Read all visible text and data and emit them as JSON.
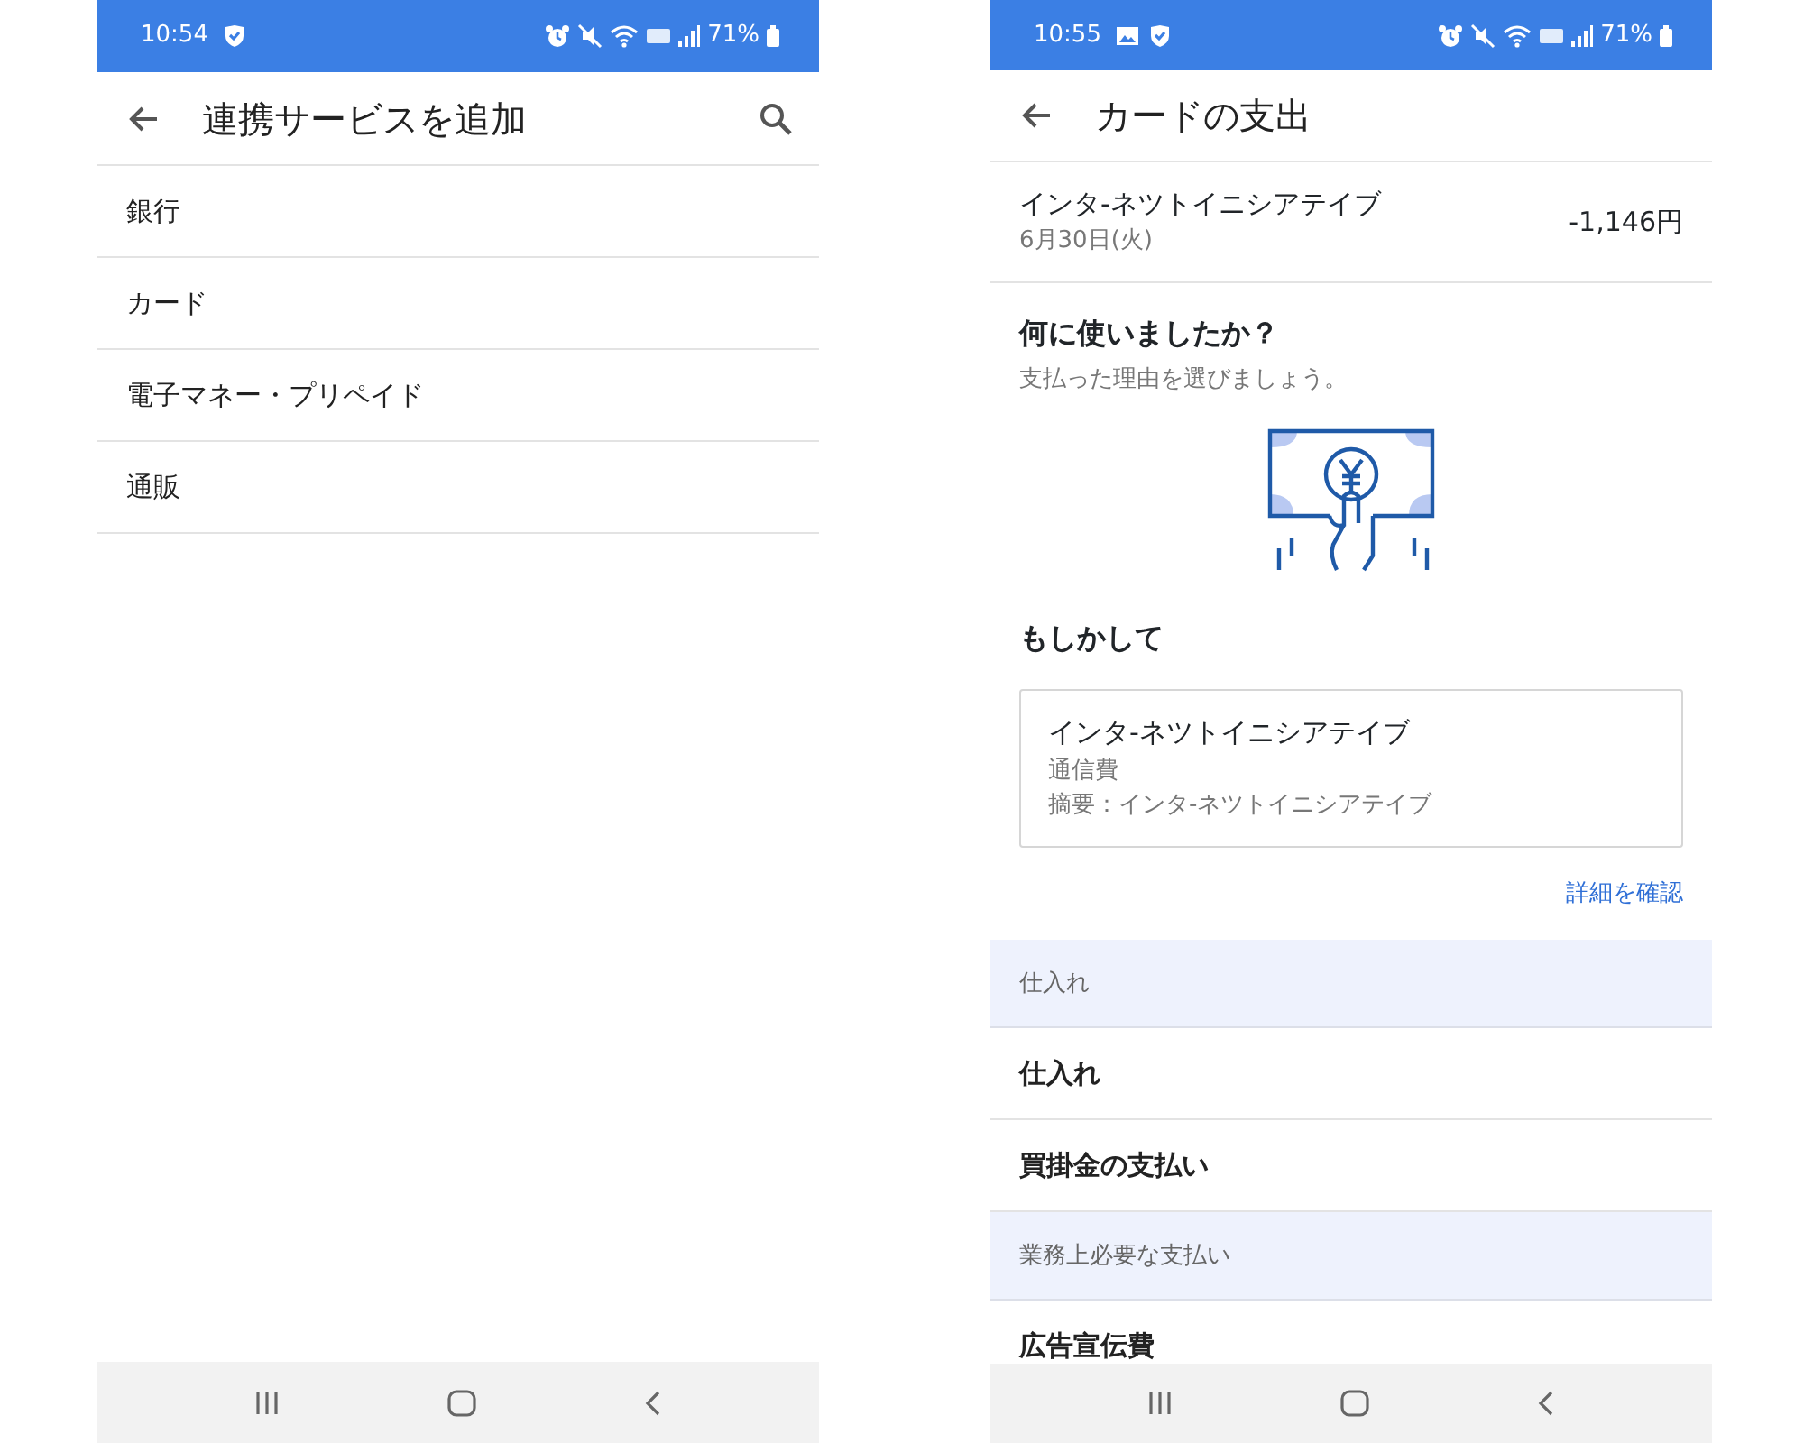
{
  "screens": [
    {
      "kind": "service_list",
      "status_bar": {
        "time": "10:54",
        "notifications": [
          {
            "kind": "shield"
          }
        ],
        "battery": "71%"
      },
      "title": "連携サービスを追加",
      "search": true,
      "items": [
        {
          "label": "銀行"
        },
        {
          "label": "カード"
        },
        {
          "label": "電子マネー・プリペイド"
        },
        {
          "label": "通販"
        }
      ]
    },
    {
      "kind": "expense_detail",
      "status_bar": {
        "time": "10:55",
        "notifications": [
          {
            "kind": "image"
          },
          {
            "kind": "shield"
          }
        ],
        "battery": "71%"
      },
      "title": "カードの支出",
      "search": false,
      "transaction": {
        "name": "インタ-ネツトイニシアテイブ",
        "date": "6月30日(火)",
        "amount": "-1,146円"
      },
      "question": {
        "title": "何に使いましたか？",
        "subtitle": "支払った理由を選びましょう。"
      },
      "suggestion_label": "もしかして",
      "suggestion": {
        "name": "インタ-ネツトイニシアテイブ",
        "category": "通信費",
        "summary": "摘要：インタ-ネツトイニシアテイブ"
      },
      "details_link": "詳細を確認",
      "categories": [
        {
          "kind": "header",
          "label": "仕入れ"
        },
        {
          "kind": "item",
          "label": "仕入れ"
        },
        {
          "kind": "item",
          "label": "買掛金の支払い"
        },
        {
          "kind": "header",
          "label": "業務上必要な支払い"
        },
        {
          "kind": "item",
          "label": "広告宣伝費"
        }
      ]
    }
  ]
}
